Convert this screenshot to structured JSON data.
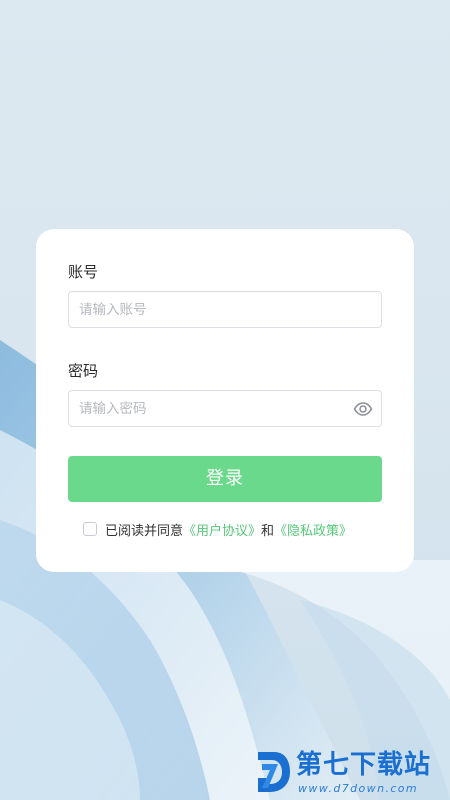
{
  "form": {
    "account_label": "账号",
    "account_placeholder": "请输入账号",
    "account_value": "",
    "password_label": "密码",
    "password_placeholder": "请输入密码",
    "password_value": "",
    "password_toggle_icon": "eye-icon",
    "login_label": "登录",
    "agree_checked": false,
    "agree_prefix": "已阅读并同意",
    "user_agreement_link": "《用户协议》",
    "agree_and": "和",
    "privacy_policy_link": "《隐私政策》"
  },
  "watermark": {
    "title": "第七下载站",
    "url": "www.d7down.com"
  },
  "colors": {
    "accent": "#6ad98c",
    "link": "#57c87a",
    "background": "#dde9f1",
    "card": "#ffffff",
    "watermark": "#1a6fd0"
  }
}
